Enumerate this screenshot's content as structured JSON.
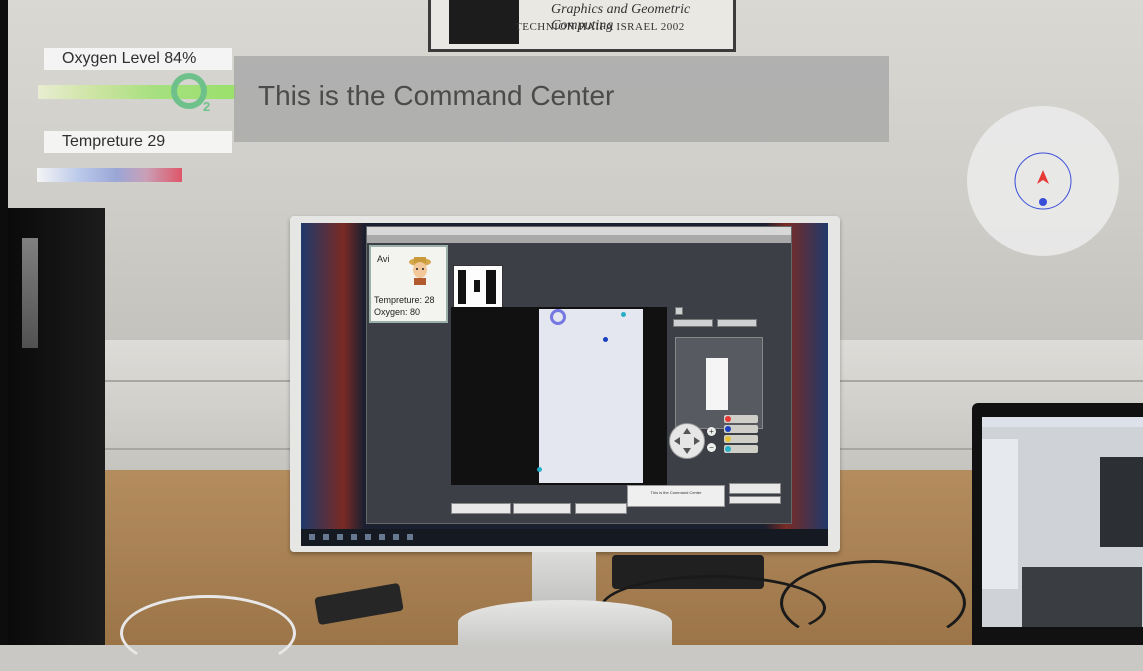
{
  "hud": {
    "oxygen_label": "Oxygen Level 84%",
    "oxygen_level": 0.84,
    "temperature_label": "Tempreture 29",
    "temperature_value": 29,
    "command_text": "This is the Command Center",
    "oxygen_icon": "o2-icon",
    "compass_icon": "compass-icon"
  },
  "room": {
    "plaque_line1": "Graphics and Geometric Computing",
    "plaque_line2": "TECHNION HAIFA ISRAEL 2002"
  },
  "monitor_app": {
    "avatar_name": "Avi",
    "avatar_temperature": "Tempreture: 28",
    "avatar_oxygen": "Oxygen: 80",
    "mini_command_text": "This is the Command Center"
  },
  "colors": {
    "oxygen_bar": "#9be06c",
    "temperature_hot": "#df5668",
    "temperature_cold": "#9aa6d6",
    "compass_ring": "#3a4fd8",
    "compass_arrow": "#e53935"
  }
}
